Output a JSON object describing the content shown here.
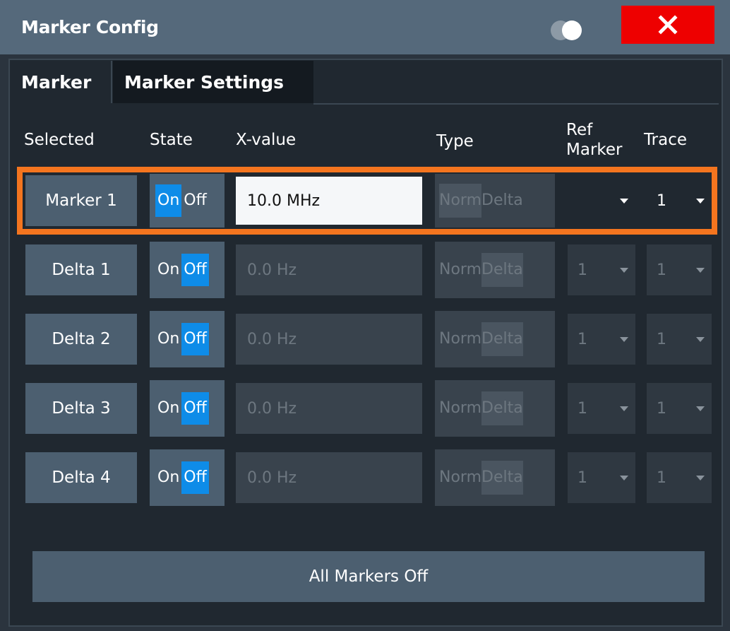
{
  "window": {
    "title": "Marker Config",
    "close_icon": "close-icon",
    "toggle_icon": "display-toggle-icon"
  },
  "tabs": [
    {
      "label": "Marker",
      "active": true
    },
    {
      "label": "Marker Settings",
      "active": false
    }
  ],
  "columns": {
    "selected": "Selected",
    "state": "State",
    "xvalue": "X-value",
    "type": "Type",
    "ref_marker": "Ref Marker",
    "trace": "Trace"
  },
  "rows": [
    {
      "name": "Marker 1",
      "on": "On",
      "off": "Off",
      "state": "on",
      "xvalue": "10.0 MHz",
      "norm": "Norm",
      "delta": "Delta",
      "ref": "",
      "trace": "1"
    },
    {
      "name": "Delta 1",
      "on": "On",
      "off": "Off",
      "state": "off",
      "xvalue": "0.0 Hz",
      "norm": "Norm",
      "delta": "Delta",
      "ref": "1",
      "trace": "1"
    },
    {
      "name": "Delta 2",
      "on": "On",
      "off": "Off",
      "state": "off",
      "xvalue": "0.0 Hz",
      "norm": "Norm",
      "delta": "Delta",
      "ref": "1",
      "trace": "1"
    },
    {
      "name": "Delta 3",
      "on": "On",
      "off": "Off",
      "state": "off",
      "xvalue": "0.0 Hz",
      "norm": "Norm",
      "delta": "Delta",
      "ref": "1",
      "trace": "1"
    },
    {
      "name": "Delta 4",
      "on": "On",
      "off": "Off",
      "state": "off",
      "xvalue": "0.0 Hz",
      "norm": "Norm",
      "delta": "Delta",
      "ref": "1",
      "trace": "1"
    }
  ],
  "footer": {
    "all_markers_off": "All Markers Off"
  },
  "colors": {
    "accent_on": "#0e8ce8",
    "selection": "#f4751f",
    "close": "#ee0000"
  }
}
